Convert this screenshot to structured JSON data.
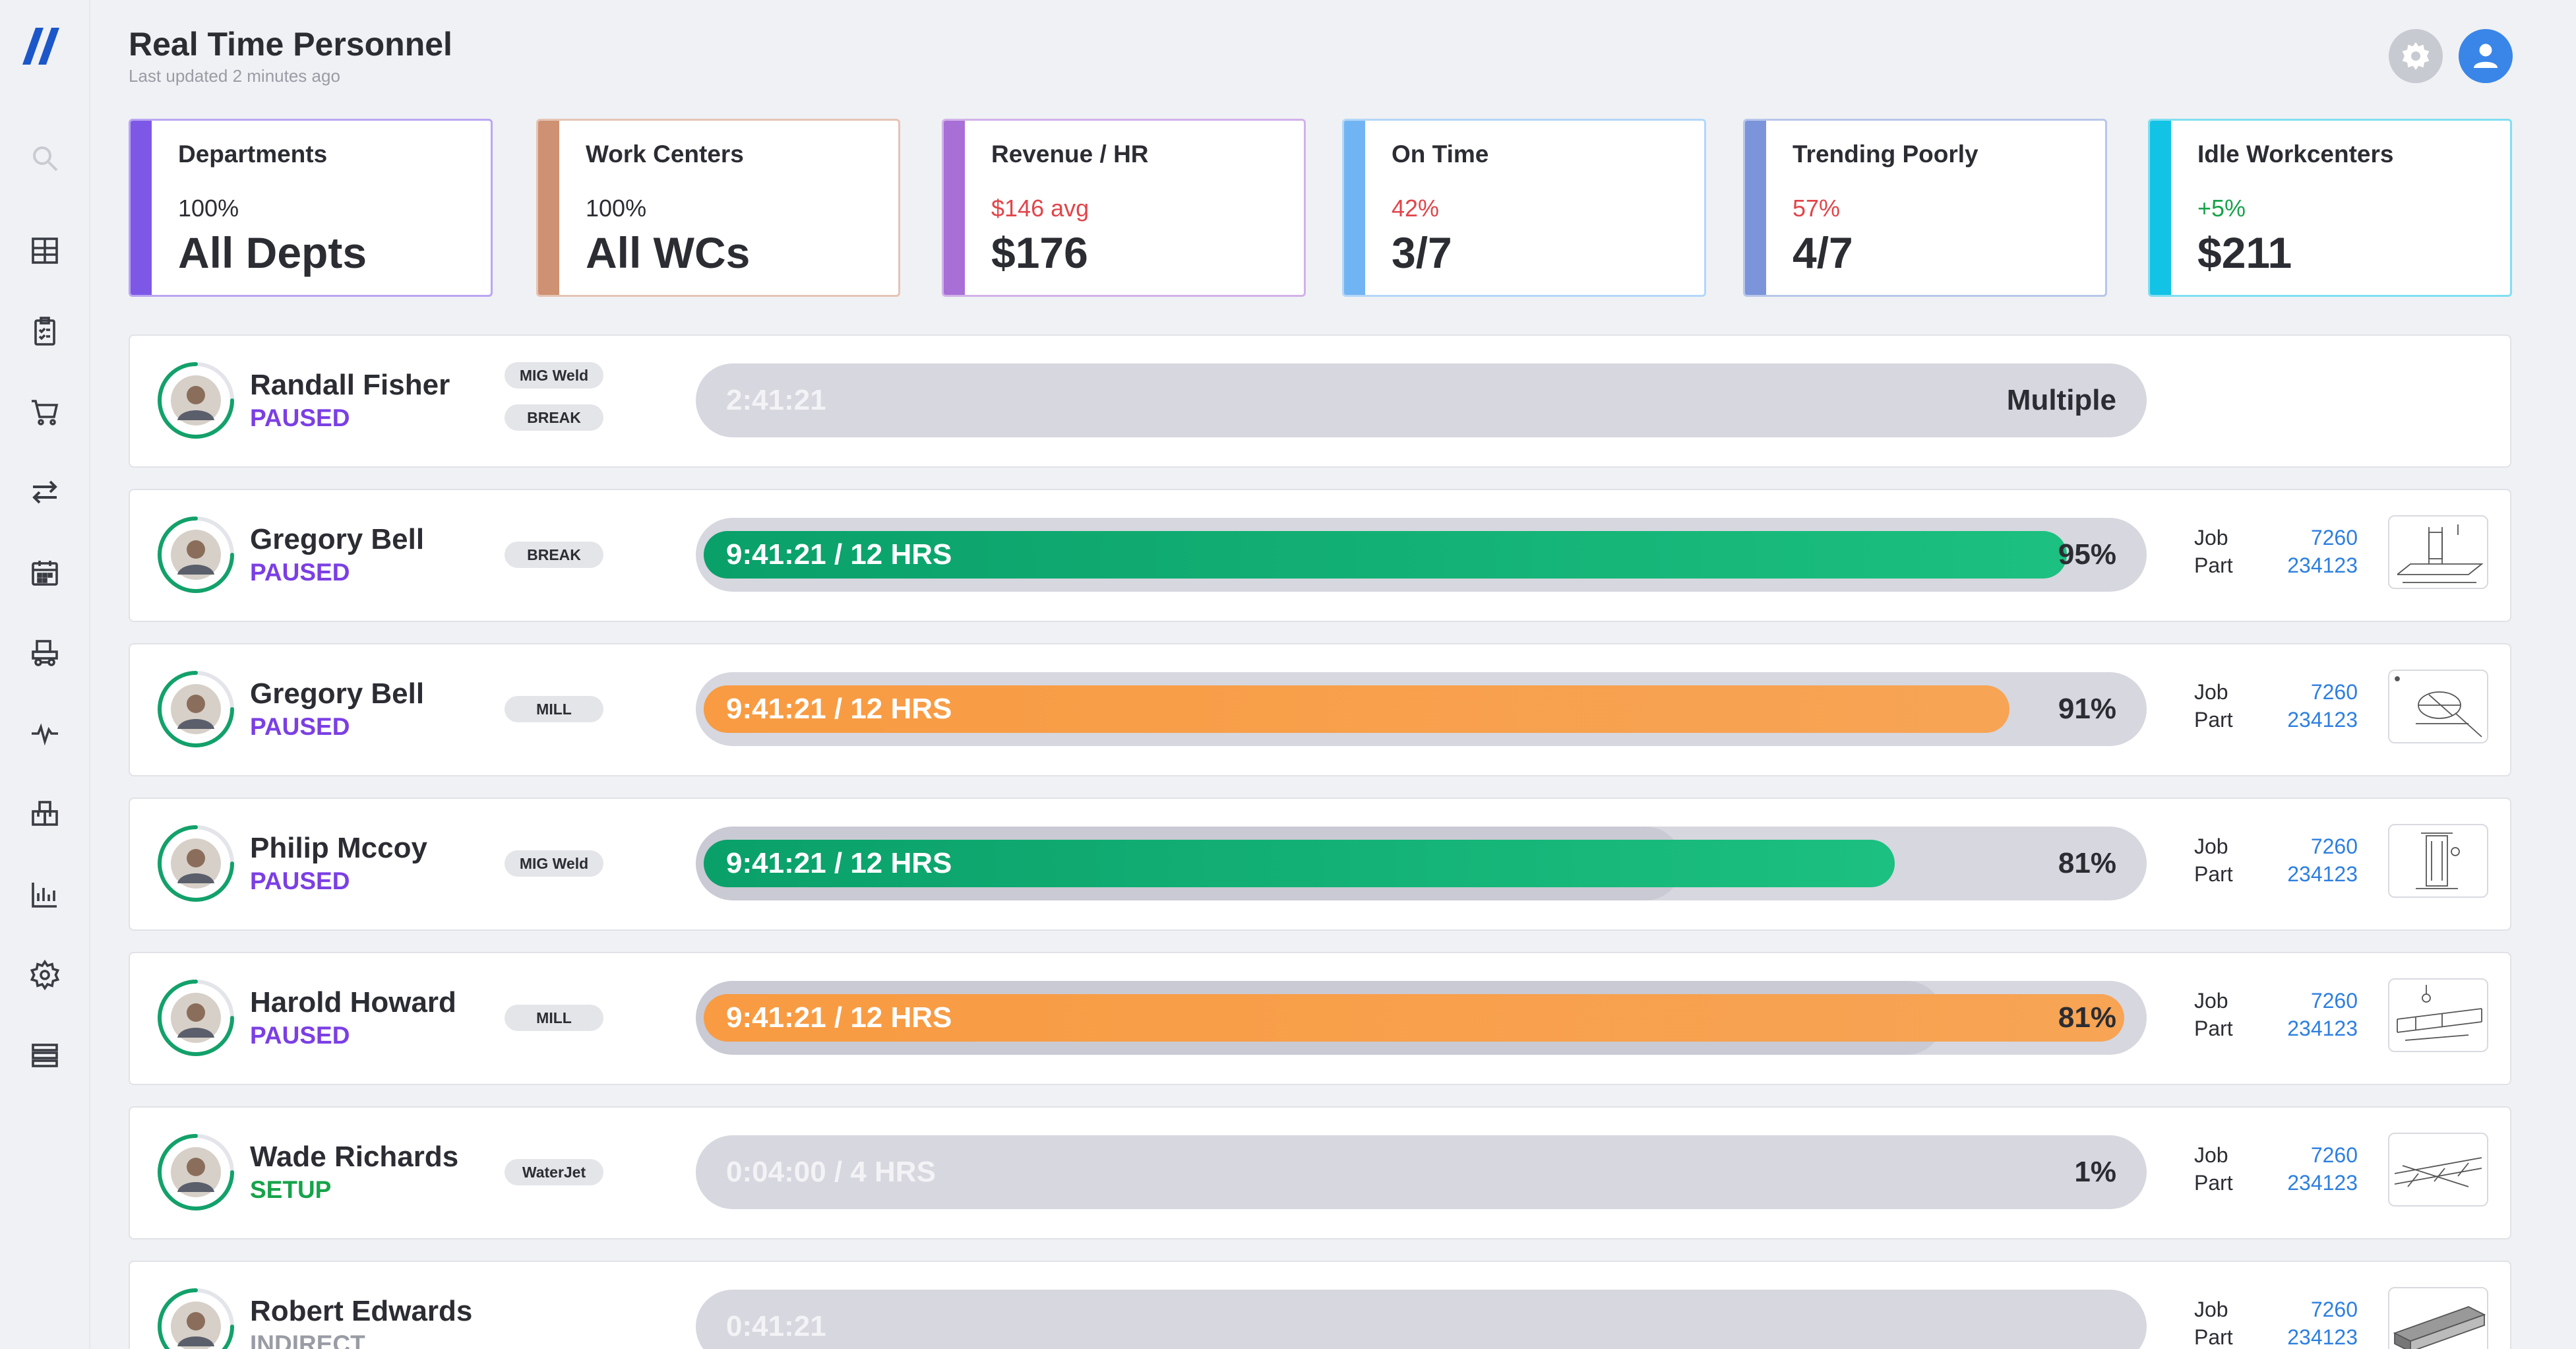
{
  "header": {
    "title": "Real Time Personnel",
    "subtitle": "Last updated 2 minutes ago"
  },
  "sidebar": {
    "items": [
      {
        "icon": "search-icon"
      },
      {
        "icon": "dashboard-icon"
      },
      {
        "icon": "clipboard-icon"
      },
      {
        "icon": "cart-icon"
      },
      {
        "icon": "transfer-icon"
      },
      {
        "icon": "calendar-icon"
      },
      {
        "icon": "machine-icon"
      },
      {
        "icon": "activity-icon"
      },
      {
        "icon": "inventory-icon"
      },
      {
        "icon": "bar-chart-icon"
      },
      {
        "icon": "gear-icon"
      },
      {
        "icon": "server-icon"
      }
    ]
  },
  "colors": {
    "paused": "#7b3fe4",
    "setup": "#16a34a",
    "indirect": "#9a9ca5",
    "green_bar": "#12b07a",
    "orange_bar": "#f79d48",
    "link": "#2d7fe0"
  },
  "kpis": [
    {
      "label": "Departments",
      "sub": "100%",
      "value": "All Depts",
      "accent": "#7d58e6",
      "sub_color": "#2b2d33"
    },
    {
      "label": "Work Centers",
      "sub": "100%",
      "value": "All WCs",
      "accent": "#cf9173",
      "sub_color": "#2b2d33"
    },
    {
      "label": "Revenue / HR",
      "sub": "$146 avg",
      "value": "$176",
      "accent": "#a86fd6",
      "sub_color": "#e0454a"
    },
    {
      "label": "On Time",
      "sub": "42%",
      "value": "3/7",
      "accent": "#71b4f3",
      "sub_color": "#e0454a"
    },
    {
      "label": "Trending Poorly",
      "sub": "57%",
      "value": "4/7",
      "accent": "#7b94da",
      "sub_color": "#e0454a"
    },
    {
      "label": "Idle Workcenters",
      "sub": "+5%",
      "value": "$211",
      "accent": "#13c3e6",
      "sub_color": "#16a34a"
    }
  ],
  "job_labels": {
    "job": "Job",
    "part": "Part"
  },
  "personnel": [
    {
      "name": "Randall Fisher",
      "status": "PAUSED",
      "tags": [
        "MIG Weld",
        "BREAK"
      ],
      "bar_text": "2:41:21",
      "bar_end": "Multiple",
      "fill_fraction": 0,
      "ghost_fraction": 0,
      "bar_color": "none",
      "job": "",
      "part": ""
    },
    {
      "name": "Gregory Bell",
      "status": "PAUSED",
      "tags": [
        "BREAK"
      ],
      "bar_text": "9:41:21 / 12 HRS",
      "bar_end": "95%",
      "fill_fraction": 0.95,
      "ghost_fraction": 0,
      "bar_color": "green",
      "job": "7260",
      "part": "234123"
    },
    {
      "name": "Gregory Bell",
      "status": "PAUSED",
      "tags": [
        "MILL"
      ],
      "bar_text": "9:41:21 / 12 HRS",
      "bar_end": "91%",
      "fill_fraction": 0.91,
      "ghost_fraction": 0,
      "bar_color": "orange",
      "job": "7260",
      "part": "234123"
    },
    {
      "name": "Philip Mccoy",
      "status": "PAUSED",
      "tags": [
        "MIG Weld"
      ],
      "bar_text": "9:41:21 / 12 HRS",
      "bar_end": "81%",
      "fill_fraction": 0.83,
      "ghost_fraction": 0.68,
      "bar_color": "green",
      "job": "7260",
      "part": "234123"
    },
    {
      "name": "Harold Howard",
      "status": "PAUSED",
      "tags": [
        "MILL"
      ],
      "bar_text": "9:41:21 / 12 HRS",
      "bar_end": "81%",
      "fill_fraction": 0.99,
      "ghost_fraction": 0.86,
      "bar_color": "orange",
      "job": "7260",
      "part": "234123"
    },
    {
      "name": "Wade Richards",
      "status": "SETUP",
      "tags": [
        "WaterJet"
      ],
      "bar_text": "0:04:00 / 4 HRS",
      "bar_end": "1%",
      "fill_fraction": 0,
      "ghost_fraction": 0,
      "bar_color": "none",
      "job": "7260",
      "part": "234123"
    },
    {
      "name": "Robert Edwards",
      "status": "INDIRECT",
      "tags": [],
      "bar_text": "0:41:21",
      "bar_end": "",
      "fill_fraction": 0,
      "ghost_fraction": 0,
      "bar_color": "none",
      "job": "7260",
      "part": "234123"
    }
  ]
}
